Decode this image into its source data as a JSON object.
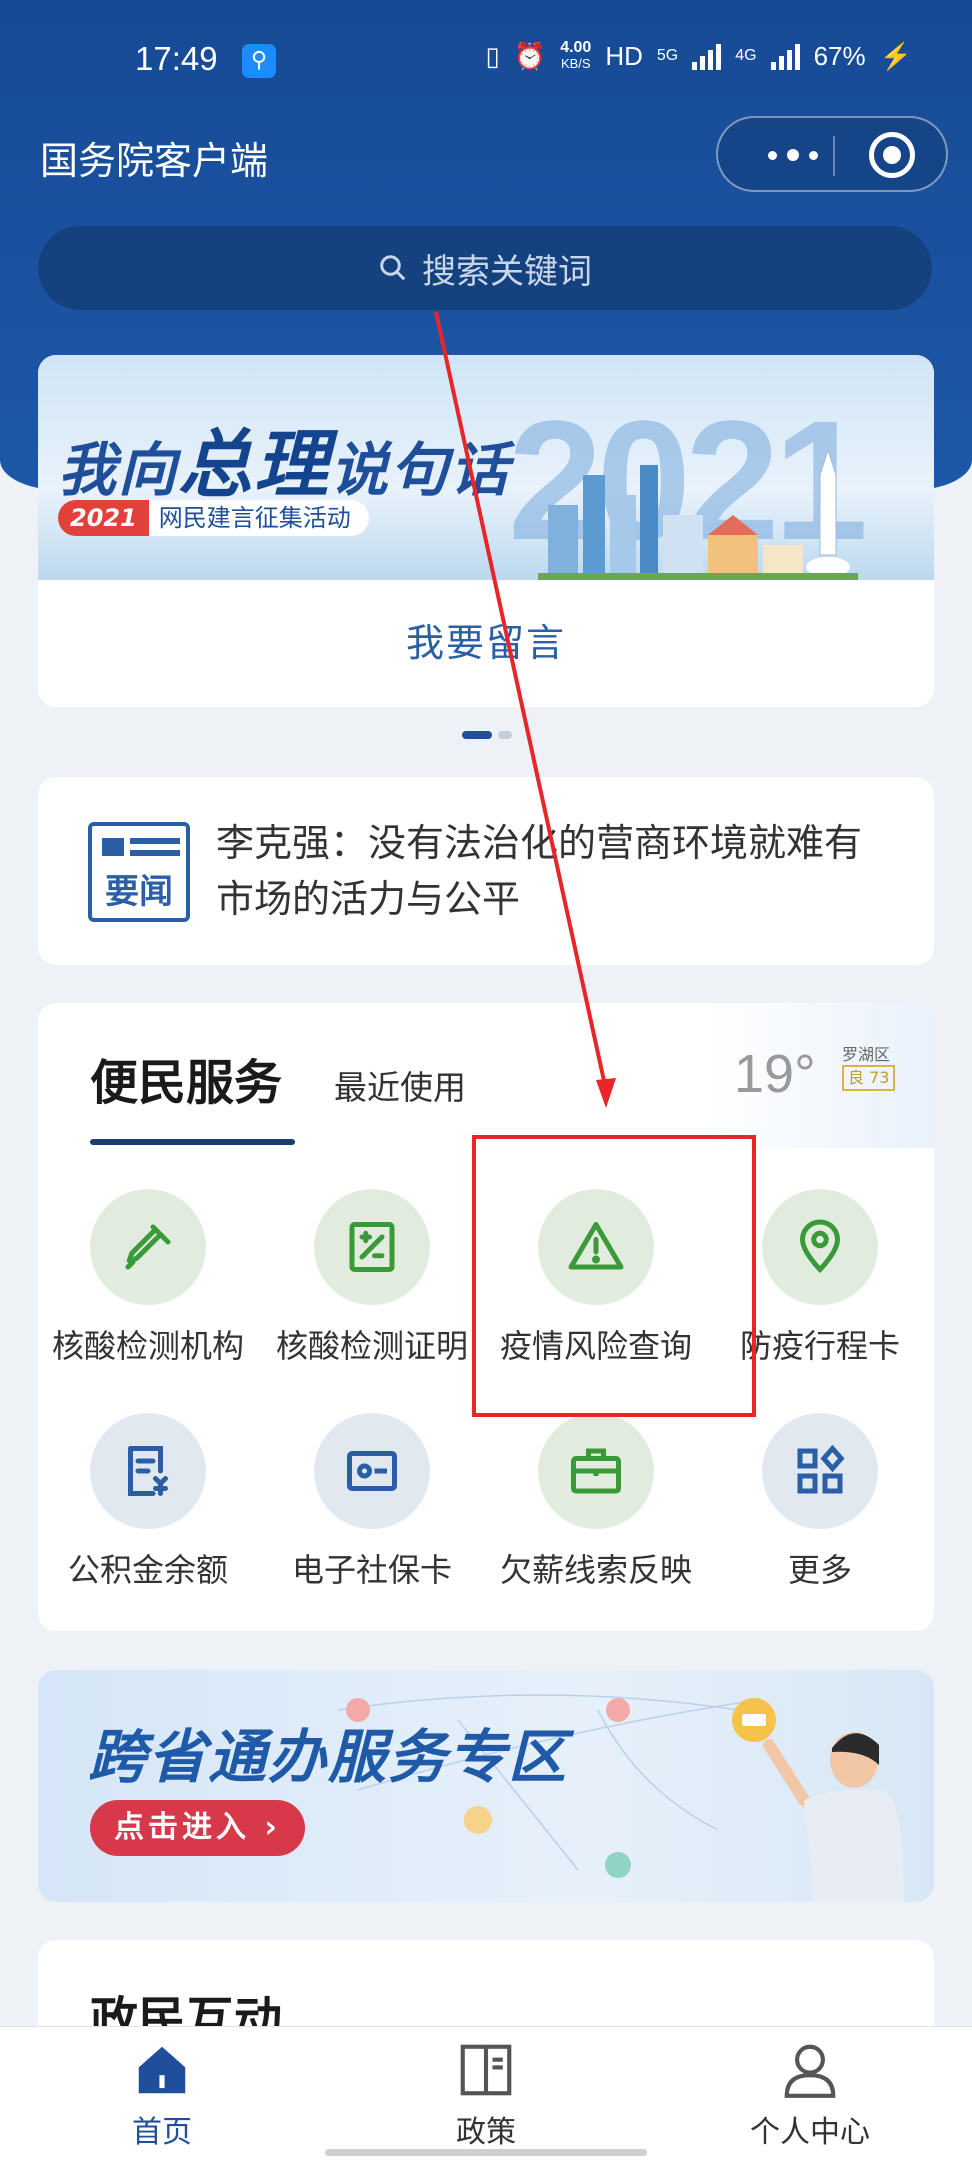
{
  "status_bar": {
    "time": "17:49",
    "speed_value": "4.00",
    "speed_unit": "KB/S",
    "hd": "HD",
    "net1": "5G",
    "net2": "4G",
    "battery": "67%"
  },
  "app": {
    "title": "国务院客户端"
  },
  "search": {
    "placeholder": "搜索关键词"
  },
  "banner": {
    "title_pre": "我向",
    "title_big": "总理",
    "title_post": "说句话",
    "tag_year": "2021",
    "tag_text": "网民建言征集活动",
    "year_art": "2021",
    "link": "我要留言"
  },
  "news": {
    "icon_label": "要闻",
    "headline": "李克强：没有法治化的营商环境就难有市场的活力与公平"
  },
  "services": {
    "tab_main": "便民服务",
    "tab_sub": "最近使用",
    "weather": {
      "temp": "19°",
      "area": "罗湖区",
      "aqi": "良 73"
    },
    "items": [
      {
        "label": "核酸检测机构",
        "icon": "dropper-icon"
      },
      {
        "label": "核酸检测证明",
        "icon": "test-certificate-icon"
      },
      {
        "label": "疫情风险查询",
        "icon": "warning-triangle-icon"
      },
      {
        "label": "防疫行程卡",
        "icon": "location-pin-icon"
      },
      {
        "label": "公积金余额",
        "icon": "fund-document-icon"
      },
      {
        "label": "电子社保卡",
        "icon": "id-card-icon"
      },
      {
        "label": "欠薪线索反映",
        "icon": "briefcase-icon"
      },
      {
        "label": "更多",
        "icon": "grid-more-icon"
      }
    ]
  },
  "cross_banner": {
    "title": "跨省通办服务专区",
    "button": "点击进入 ›"
  },
  "interaction": {
    "title": "政民互动"
  },
  "tabbar": {
    "items": [
      {
        "label": "首页",
        "icon": "home-icon",
        "active": true
      },
      {
        "label": "政策",
        "icon": "book-icon",
        "active": false
      },
      {
        "label": "个人中心",
        "icon": "user-icon",
        "active": false
      }
    ]
  },
  "colors": {
    "header_blue": "#1d58a8",
    "service_green": "#3a9a3a",
    "service_blue": "#2a5fa6",
    "highlight_red": "#e8262a",
    "tab_active": "#1f4e9a"
  }
}
